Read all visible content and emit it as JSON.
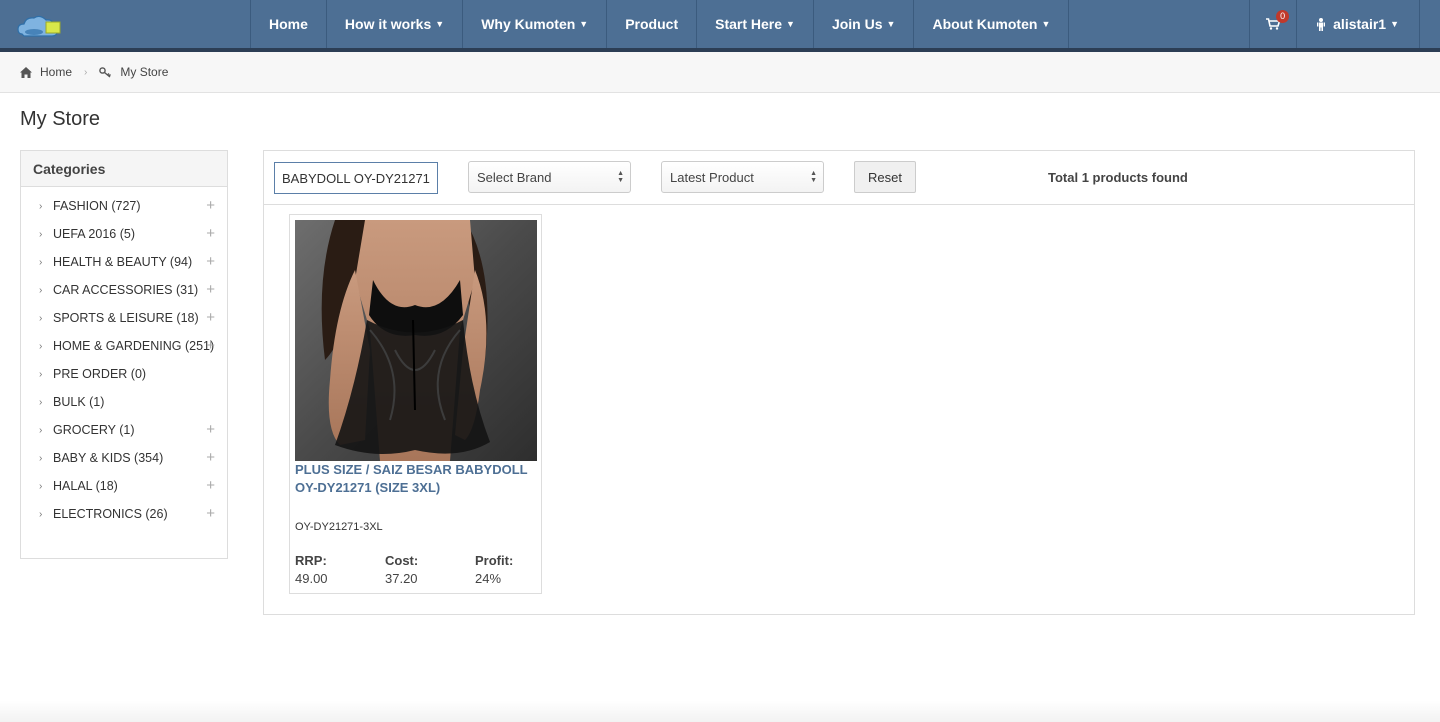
{
  "colors": {
    "navbar": "#4d6f94",
    "navbar_border": "#2c3e55",
    "link": "#4d6f94",
    "badge": "#c0392b"
  },
  "nav": {
    "logo_icon": "kumoten-cloud-logo",
    "items": [
      {
        "label": "Home",
        "dropdown": false
      },
      {
        "label": "How it works",
        "dropdown": true
      },
      {
        "label": "Why Kumoten",
        "dropdown": true
      },
      {
        "label": "Product",
        "dropdown": false
      },
      {
        "label": "Start Here",
        "dropdown": true
      },
      {
        "label": "Join Us",
        "dropdown": true
      },
      {
        "label": "About Kumoten",
        "dropdown": true
      }
    ],
    "cart_count": "0",
    "user": "alistair1"
  },
  "breadcrumb": {
    "home": "Home",
    "current": "My Store"
  },
  "page_title": "My Store",
  "sidebar": {
    "title": "Categories",
    "items": [
      {
        "label": "FASHION (727)",
        "expandable": true
      },
      {
        "label": "UEFA 2016 (5)",
        "expandable": true
      },
      {
        "label": "HEALTH & BEAUTY (94)",
        "expandable": true
      },
      {
        "label": "CAR ACCESSORIES (31)",
        "expandable": true
      },
      {
        "label": "SPORTS & LEISURE (18)",
        "expandable": true
      },
      {
        "label": "HOME & GARDENING (251)",
        "expandable": true
      },
      {
        "label": "PRE ORDER (0)",
        "expandable": false
      },
      {
        "label": "BULK (1)",
        "expandable": false
      },
      {
        "label": "GROCERY (1)",
        "expandable": true
      },
      {
        "label": "BABY & KIDS (354)",
        "expandable": true
      },
      {
        "label": "HALAL (18)",
        "expandable": true
      },
      {
        "label": "ELECTRONICS (26)",
        "expandable": true
      }
    ]
  },
  "filters": {
    "search_value": "BABYDOLL OY-DY21271",
    "brand_selected": "Select Brand",
    "sort_selected": "Latest Product",
    "reset_label": "Reset",
    "total_text": "Total 1 products found"
  },
  "product": {
    "name": "PLUS SIZE / SAIZ BESAR BABYDOLL OY-DY21271 (SIZE 3XL)",
    "sku": "OY-DY21271-3XL",
    "rrp_label": "RRP:",
    "rrp_value": "49.00",
    "cost_label": "Cost:",
    "cost_value": "37.20",
    "profit_label": "Profit:",
    "profit_value": "24%"
  }
}
